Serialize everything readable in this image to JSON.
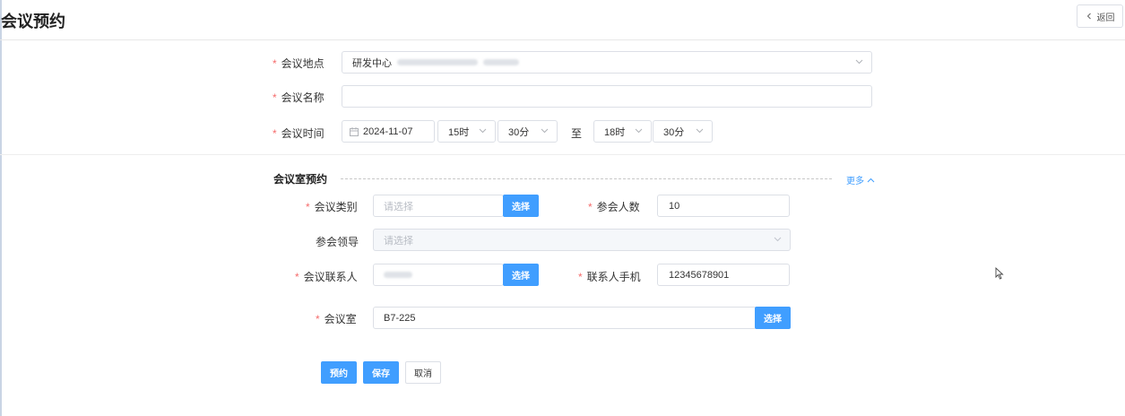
{
  "page": {
    "title": "会议预约",
    "back_label": "返回"
  },
  "form": {
    "location": {
      "label": "会议地点",
      "value": "研发中心"
    },
    "name": {
      "label": "会议名称",
      "value": ""
    },
    "time": {
      "label": "会议时间",
      "date": "2024-11-07",
      "start_hour": "15时",
      "start_minute": "30分",
      "separator": "至",
      "end_hour": "18时",
      "end_minute": "30分"
    }
  },
  "room_section": {
    "title": "会议室预约",
    "more_label": "更多",
    "category": {
      "label": "会议类别",
      "placeholder": "请选择",
      "button": "选择"
    },
    "attendees": {
      "label": "参会人数",
      "value": "10"
    },
    "leader": {
      "label": "参会领导",
      "placeholder": "请选择"
    },
    "contact": {
      "label": "会议联系人",
      "value": "",
      "button": "选择"
    },
    "phone": {
      "label": "联系人手机",
      "value": "12345678901"
    },
    "room": {
      "label": "会议室",
      "value": "B7-225",
      "button": "选择"
    }
  },
  "actions": {
    "reserve": "预约",
    "save": "保存",
    "cancel": "取消"
  },
  "colors": {
    "primary": "#409eff",
    "required": "#f56c6c",
    "border": "#dcdfe6"
  },
  "icons": [
    "chevron-left-icon",
    "chevron-down-icon",
    "calendar-icon",
    "chevron-up-icon",
    "mouse-cursor-icon"
  ]
}
